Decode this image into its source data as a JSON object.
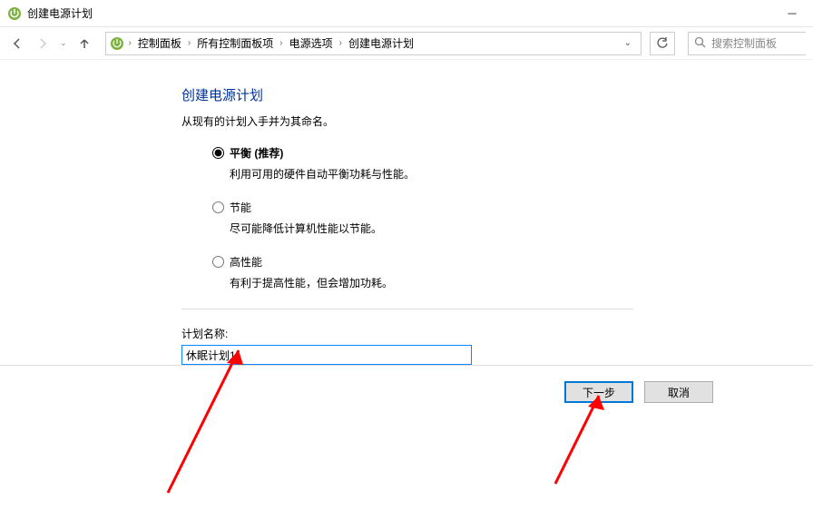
{
  "window": {
    "title": "创建电源计划"
  },
  "breadcrumb": {
    "items": [
      "控制面板",
      "所有控制面板项",
      "电源选项",
      "创建电源计划"
    ]
  },
  "search": {
    "placeholder": "搜索控制面板"
  },
  "page": {
    "title": "创建电源计划",
    "subtitle": "从现有的计划入手并为其命名。"
  },
  "options": [
    {
      "label": "平衡 (推荐)",
      "desc": "利用可用的硬件自动平衡功耗与性能。",
      "selected": true
    },
    {
      "label": "节能",
      "desc": "尽可能降低计算机性能以节能。",
      "selected": false
    },
    {
      "label": "高性能",
      "desc": "有利于提高性能，但会增加功耗。",
      "selected": false
    }
  ],
  "planName": {
    "label": "计划名称:",
    "value": "休眠计划1"
  },
  "buttons": {
    "next": "下一步",
    "cancel": "取消"
  }
}
